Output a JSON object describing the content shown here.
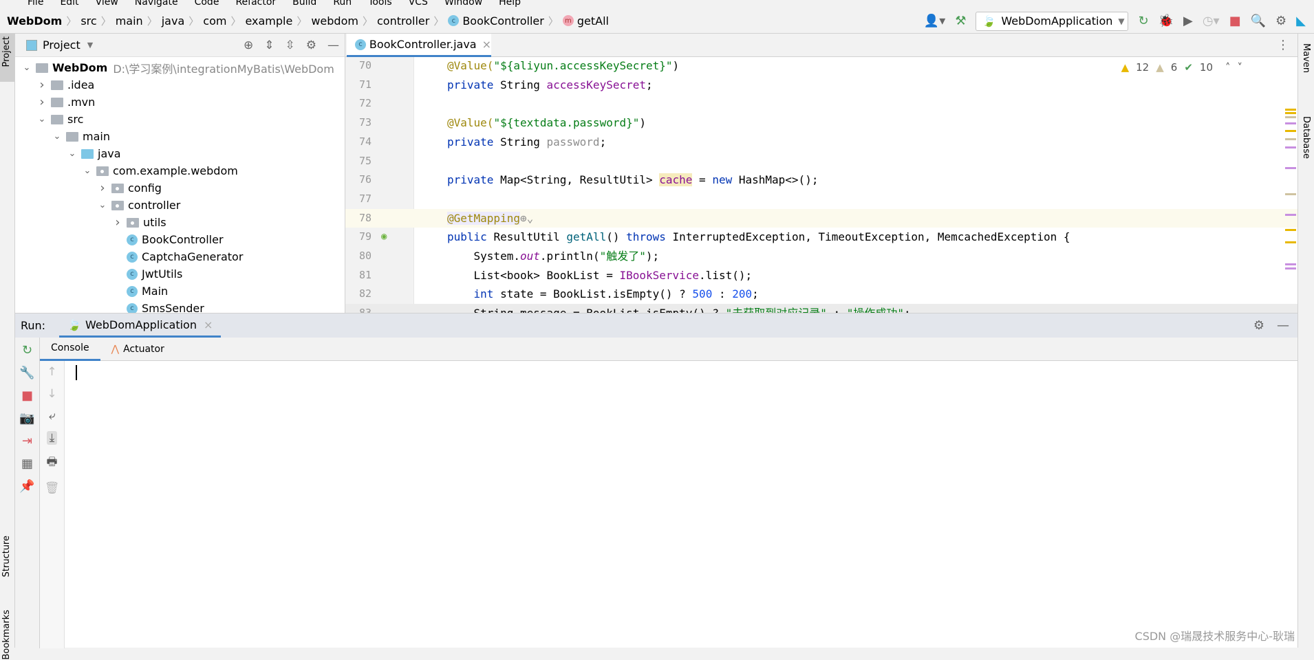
{
  "menu": [
    "File",
    "Edit",
    "View",
    "Navigate",
    "Code",
    "Refactor",
    "Build",
    "Run",
    "Tools",
    "VCS",
    "Window",
    "Help"
  ],
  "breadcrumb": [
    "WebDom",
    "src",
    "main",
    "java",
    "com",
    "example",
    "webdom",
    "controller",
    "BookController",
    "getAll"
  ],
  "run_config": "WebDomApplication",
  "project": {
    "title": "Project",
    "tree": [
      {
        "label": "WebDom",
        "extra": "D:\\学习案例\\integrationMyBatis\\WebDom",
        "depth": 0,
        "chev": "down",
        "icon": "module"
      },
      {
        "label": ".idea",
        "depth": 1,
        "chev": "right",
        "icon": "folder"
      },
      {
        "label": ".mvn",
        "depth": 1,
        "chev": "right",
        "icon": "folder"
      },
      {
        "label": "src",
        "depth": 1,
        "chev": "down",
        "icon": "folder"
      },
      {
        "label": "main",
        "depth": 2,
        "chev": "down",
        "icon": "folder"
      },
      {
        "label": "java",
        "depth": 3,
        "chev": "down",
        "icon": "source-folder"
      },
      {
        "label": "com.example.webdom",
        "depth": 4,
        "chev": "down",
        "icon": "package"
      },
      {
        "label": "config",
        "depth": 5,
        "chev": "right",
        "icon": "package"
      },
      {
        "label": "controller",
        "depth": 5,
        "chev": "down",
        "icon": "package"
      },
      {
        "label": "utils",
        "depth": 6,
        "chev": "right",
        "icon": "package"
      },
      {
        "label": "BookController",
        "depth": 6,
        "icon": "class"
      },
      {
        "label": "CaptchaGenerator",
        "depth": 6,
        "icon": "class"
      },
      {
        "label": "JwtUtils",
        "depth": 6,
        "icon": "class"
      },
      {
        "label": "Main",
        "depth": 6,
        "icon": "class-main"
      },
      {
        "label": "SmsSender",
        "depth": 6,
        "icon": "class"
      }
    ]
  },
  "editor": {
    "tab": "BookController.java",
    "inspections": {
      "warnings": "12",
      "weak_warnings": "6",
      "typos": "10"
    },
    "current_line": 78,
    "lines": [
      {
        "n": "70",
        "t": [
          [
            "@Value(",
            "a"
          ],
          [
            "\"${aliyun.accessKeySecret}\"",
            "s"
          ],
          [
            ")",
            ""
          ]
        ]
      },
      {
        "n": "71",
        "t": [
          [
            "private ",
            "k"
          ],
          [
            "String ",
            ""
          ],
          [
            "accessKeySecret",
            "f"
          ],
          [
            ";",
            ""
          ]
        ]
      },
      {
        "n": "72",
        "t": []
      },
      {
        "n": "73",
        "t": [
          [
            "@Value(",
            "a"
          ],
          [
            "\"${textdata.password}\"",
            "s"
          ],
          [
            ")",
            ""
          ]
        ]
      },
      {
        "n": "74",
        "t": [
          [
            "private ",
            "k"
          ],
          [
            "String ",
            ""
          ],
          [
            "password",
            "g"
          ],
          [
            ";",
            ""
          ]
        ]
      },
      {
        "n": "75",
        "t": []
      },
      {
        "n": "76",
        "t": [
          [
            "private ",
            "k"
          ],
          [
            "Map<String, ResultUtil> ",
            ""
          ],
          [
            "cache",
            "f hl"
          ],
          [
            " = ",
            ""
          ],
          [
            "new ",
            "k"
          ],
          [
            "HashMap<>();",
            ""
          ]
        ]
      },
      {
        "n": "77",
        "t": []
      },
      {
        "n": "78",
        "t": [
          [
            "@GetMapping",
            "a ann"
          ],
          [
            "⊕⌄",
            "g"
          ]
        ]
      },
      {
        "n": "79",
        "t": [
          [
            "public ",
            "k"
          ],
          [
            "ResultUtil ",
            ""
          ],
          [
            "getAll",
            "m"
          ],
          [
            "() ",
            ""
          ],
          [
            "throws ",
            "k"
          ],
          [
            "InterruptedException, TimeoutException, MemcachedException {",
            ""
          ]
        ]
      },
      {
        "n": "80",
        "t": [
          [
            "    System.",
            ""
          ],
          [
            "out",
            "i"
          ],
          [
            ".println(",
            ""
          ],
          [
            "\"触发了\"",
            "s"
          ],
          [
            ");",
            ""
          ]
        ]
      },
      {
        "n": "81",
        "t": [
          [
            "    List<book> BookList = ",
            ""
          ],
          [
            "IBookService",
            "f"
          ],
          [
            ".list();",
            ""
          ]
        ]
      },
      {
        "n": "82",
        "t": [
          [
            "    ",
            ""
          ],
          [
            "int ",
            "k"
          ],
          [
            "state = BookList.isEmpty() ? ",
            ""
          ],
          [
            "500",
            "n"
          ],
          [
            " : ",
            ""
          ],
          [
            "200",
            "n"
          ],
          [
            ";",
            ""
          ]
        ]
      },
      {
        "n": "83",
        "t": [
          [
            "    String message = BookList.isEmpty() ? ",
            ""
          ],
          [
            "\"未获取到对应记录\"",
            "s"
          ],
          [
            " : ",
            ""
          ],
          [
            "\"操作成功\"",
            "s"
          ],
          [
            ";",
            ""
          ]
        ]
      }
    ]
  },
  "run": {
    "label": "Run:",
    "tab": "WebDomApplication",
    "subtabs": [
      "Console",
      "Actuator"
    ]
  },
  "side": {
    "project": "Project",
    "structure": "Structure",
    "bookmarks": "Bookmarks",
    "maven": "Maven",
    "database": "Database"
  },
  "watermark": "CSDN @瑞晟技术服务中心-耿瑞",
  "colors": {
    "accent": "#4083c9",
    "stop": "#db5860",
    "run": "#499c54"
  }
}
